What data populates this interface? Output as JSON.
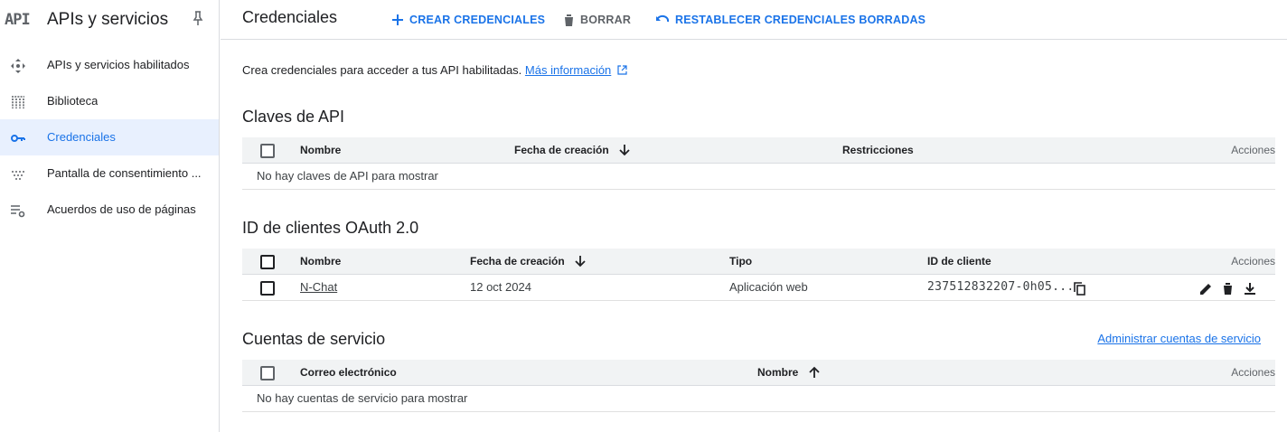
{
  "sidebar": {
    "logo": "API",
    "title": "APIs y servicios",
    "items": [
      {
        "label": "APIs y servicios habilitados",
        "icon": "apis-services-icon"
      },
      {
        "label": "Biblioteca",
        "icon": "library-icon"
      },
      {
        "label": "Credenciales",
        "icon": "key-icon"
      },
      {
        "label": "Pantalla de consentimiento ...",
        "icon": "consent-icon"
      },
      {
        "label": "Acuerdos de uso de páginas",
        "icon": "settings-list-icon"
      }
    ]
  },
  "toolbar": {
    "title": "Credenciales",
    "create_label": "CREAR CREDENCIALES",
    "delete_label": "BORRAR",
    "restore_label": "RESTABLECER CREDENCIALES BORRADAS"
  },
  "intro": {
    "text": "Crea credenciales para acceder a tus API habilitadas.",
    "link": "Más información"
  },
  "api_keys": {
    "title": "Claves de API",
    "columns": {
      "name": "Nombre",
      "created": "Fecha de creación",
      "restrictions": "Restricciones",
      "actions": "Acciones"
    },
    "empty": "No hay claves de API para mostrar"
  },
  "oauth": {
    "title": "ID de clientes OAuth 2.0",
    "columns": {
      "name": "Nombre",
      "created": "Fecha de creación",
      "type": "Tipo",
      "client_id": "ID de cliente",
      "actions": "Acciones"
    },
    "rows": [
      {
        "name": "N-Chat",
        "created": "12 oct 2024",
        "type": "Aplicación web",
        "client_id": "237512832207-0h05..."
      }
    ]
  },
  "service_accounts": {
    "title": "Cuentas de servicio",
    "manage_link": "Administrar cuentas de servicio",
    "columns": {
      "email": "Correo electrónico",
      "name": "Nombre",
      "actions": "Acciones"
    },
    "empty": "No hay cuentas de servicio para mostrar"
  },
  "colors": {
    "accent": "#1a73e8",
    "active_bg": "#e8f0fe",
    "header_bg": "#f1f3f4"
  }
}
